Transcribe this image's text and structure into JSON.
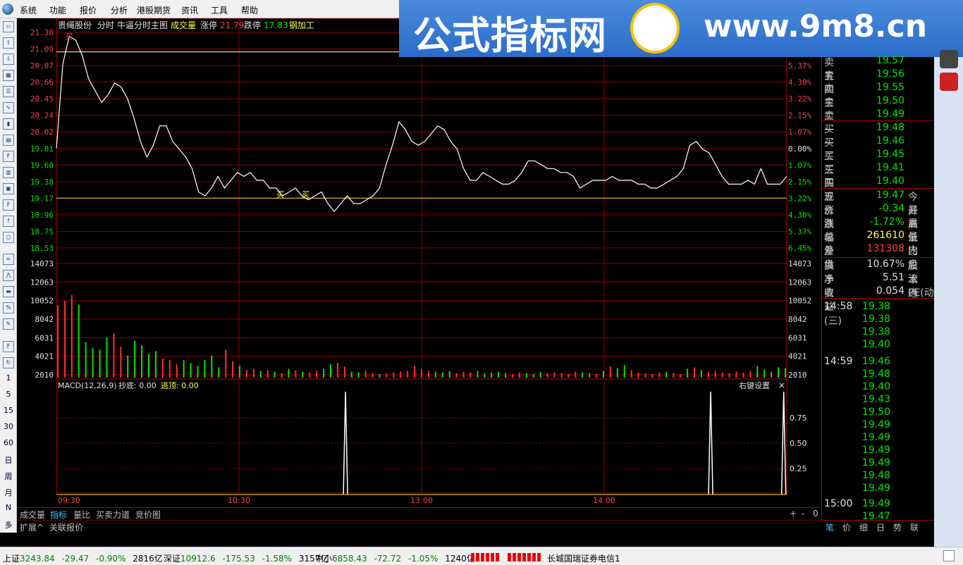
{
  "menu": [
    "系统",
    "功能",
    "报价",
    "分析",
    "港股期货",
    "资讯",
    "工具",
    "帮助"
  ],
  "watermark": {
    "cn": "公式指标网",
    "url": "www.9m8.cn"
  },
  "chart": {
    "stock_name": "贵绳股份",
    "mode": "分时",
    "indicator": "牛逼分时主图",
    "vol_label": "成交量",
    "limit_up_label": "涨停",
    "limit_up": "21.79",
    "limit_down_label": "跌停",
    "limit_down": "17.83",
    "industry": "钢加工",
    "price_ticks": [
      "21.30",
      "21.09",
      "20.87",
      "20.66",
      "20.45",
      "20.24",
      "20.02",
      "19.81",
      "19.60",
      "19.38",
      "19.17",
      "18.96",
      "18.75",
      "18.53"
    ],
    "pct_ticks": [
      "5.37%",
      "4.30%",
      "3.22%",
      "2.15%",
      "1.07%",
      "0.00%",
      "1.07%",
      "2.15%",
      "3.22%",
      "4.30%",
      "5.37%",
      "6.45%"
    ],
    "vol_ticks": [
      "14073",
      "12063",
      "10052",
      "8042",
      "6031",
      "4021",
      "2010"
    ],
    "macd_label": "MACD(12,26,9)",
    "macd_bottom": "抄底: 0.00",
    "macd_top": "逃顶: 0.00",
    "macd_setting": "右键设置",
    "macd_close": "×",
    "macd_ticks": [
      "0.75",
      "0.50",
      "0.25"
    ],
    "time_ticks": [
      "09:30",
      "10:30",
      "13:00",
      "14:00"
    ],
    "buy_mark": "买",
    "sell_marks": [
      "买",
      "买"
    ]
  },
  "chart_data": {
    "type": "line",
    "title": "贵绳股份 分时",
    "ylim": [
      18.53,
      21.3
    ],
    "price": [
      19.81,
      20.9,
      21.25,
      21.2,
      21.0,
      20.7,
      20.55,
      20.4,
      20.5,
      20.65,
      20.6,
      20.45,
      20.2,
      19.9,
      19.7,
      19.85,
      20.1,
      20.1,
      19.9,
      19.8,
      19.7,
      19.55,
      19.25,
      19.2,
      19.3,
      19.45,
      19.3,
      19.4,
      19.5,
      19.45,
      19.5,
      19.4,
      19.4,
      19.3,
      19.3,
      19.2,
      19.25,
      19.3,
      19.2,
      19.15,
      19.2,
      19.25,
      19.1,
      19.0,
      19.1,
      19.2,
      19.1,
      19.1,
      19.15,
      19.2,
      19.3,
      19.6,
      19.85,
      20.15,
      20.05,
      19.9,
      19.85,
      19.9,
      20.0,
      20.1,
      20.05,
      19.9,
      19.8,
      19.55,
      19.4,
      19.4,
      19.5,
      19.45,
      19.4,
      19.35,
      19.35,
      19.4,
      19.5,
      19.65,
      19.65,
      19.6,
      19.55,
      19.55,
      19.5,
      19.5,
      19.45,
      19.3,
      19.35,
      19.4,
      19.4,
      19.4,
      19.45,
      19.4,
      19.4,
      19.4,
      19.35,
      19.35,
      19.3,
      19.3,
      19.35,
      19.4,
      19.45,
      19.55,
      19.85,
      19.9,
      19.8,
      19.75,
      19.6,
      19.45,
      19.35,
      19.35,
      19.35,
      19.4,
      19.35,
      19.55,
      19.35,
      19.35,
      19.35,
      19.45
    ],
    "volume": [
      9800,
      10400,
      11200,
      9900,
      4800,
      4000,
      3800,
      5400,
      6000,
      4200,
      3000,
      5000,
      4400,
      3200,
      3600,
      2600,
      2400,
      1800,
      2400,
      2000,
      1600,
      2400,
      3000,
      1400,
      3800,
      2200,
      1600,
      1000,
      1200,
      900,
      1000,
      800,
      600,
      1200,
      1000,
      800,
      700,
      900,
      1200,
      1800,
      2000,
      1500,
      800,
      700,
      900,
      600,
      500,
      600,
      700,
      800,
      900,
      1600,
      1200,
      900,
      800,
      700,
      900,
      600,
      800,
      700,
      900,
      600,
      700,
      800,
      600,
      500,
      700,
      600,
      500,
      800,
      600,
      700,
      600,
      500,
      800,
      700,
      600,
      500,
      900,
      1500,
      1300,
      1700,
      1000,
      700,
      600,
      500,
      700,
      800,
      600,
      500,
      1200,
      1400,
      1000,
      800,
      900,
      700,
      600,
      800,
      700,
      900,
      1600,
      1100,
      800,
      1400,
      1300
    ],
    "macd_spikes": [
      {
        "time": "11:05",
        "value": 1.0
      },
      {
        "time": "14:35",
        "value": 1.0
      },
      {
        "time": "14:59",
        "value": 1.0
      }
    ]
  },
  "quote": {
    "asks": [
      {
        "label": "卖五",
        "price": "19.57"
      },
      {
        "label": "卖四",
        "price": "19.56"
      },
      {
        "label": "卖三",
        "price": "19.55"
      },
      {
        "label": "卖二",
        "price": "19.50"
      },
      {
        "label": "卖一",
        "price": "19.49"
      }
    ],
    "bids": [
      {
        "label": "买一",
        "price": "19.48"
      },
      {
        "label": "买二",
        "price": "19.46"
      },
      {
        "label": "买三",
        "price": "19.45"
      },
      {
        "label": "买四",
        "price": "19.41"
      },
      {
        "label": "买五",
        "price": "19.40"
      }
    ],
    "stats": [
      {
        "label": "现价",
        "value": "19.47",
        "label2": "今开",
        "cls": "green"
      },
      {
        "label": "涨跌",
        "value": "-0.34",
        "label2": "最高",
        "cls": "green"
      },
      {
        "label": "涨幅",
        "value": "-1.72%",
        "label2": "最低",
        "cls": "green"
      },
      {
        "label": "总量",
        "value": "261610",
        "label2": "量比",
        "cls": "yellow"
      },
      {
        "label": "外盘",
        "value": "131308",
        "label2": "内盘",
        "cls": "red"
      }
    ],
    "stats2": [
      {
        "label": "换手",
        "value": "10.67%",
        "label2": "股本"
      },
      {
        "label": "净资",
        "value": "5.51",
        "label2": "流通"
      },
      {
        "label": "收益(三)",
        "value": "0.054",
        "label2": "PE(动)"
      }
    ],
    "ticks": [
      {
        "time": "14:58",
        "price": "19.38"
      },
      {
        "time": "",
        "price": "19.38"
      },
      {
        "time": "",
        "price": "19.38"
      },
      {
        "time": "",
        "price": "19.40"
      },
      {
        "time": "14:59",
        "price": "19.46"
      },
      {
        "time": "",
        "price": "19.48"
      },
      {
        "time": "",
        "price": "19.40"
      },
      {
        "time": "",
        "price": "19.43"
      },
      {
        "time": "",
        "price": "19.50"
      },
      {
        "time": "",
        "price": "19.49"
      },
      {
        "time": "",
        "price": "19.49"
      },
      {
        "time": "",
        "price": "19.49"
      },
      {
        "time": "",
        "price": "19.49"
      },
      {
        "time": "",
        "price": "19.48"
      },
      {
        "time": "",
        "price": "19.49"
      },
      {
        "time": "15:00",
        "price": "19.49"
      },
      {
        "time": "",
        "price": "19.47"
      }
    ]
  },
  "bottom_tabs": [
    "成交量",
    "指标",
    "量比",
    "买卖力道",
    "竞价图"
  ],
  "bottom_controls": [
    "+",
    "-",
    "0"
  ],
  "ext_tabs": [
    "扩展^",
    "关联报价"
  ],
  "right_tabs": [
    "笔",
    "价",
    "细",
    "日",
    "势",
    "联"
  ],
  "left_nums": [
    "1",
    "5",
    "15",
    "30",
    "60",
    "日",
    "周",
    "月",
    "N",
    "多"
  ],
  "status": {
    "sh_label": "上证",
    "sh_value": "3243.84",
    "sh_chg": "-29.47",
    "sh_pct": "-0.90%",
    "sh_amt": "2816亿",
    "sz_label": "深证",
    "sz_value": "10912.6",
    "sz_chg": "-175.53",
    "sz_pct": "-1.58%",
    "sz_amt": "3157亿",
    "zx_label": "中小",
    "zx_value": "6858.43",
    "zx_chg": "-72.72",
    "zx_pct": "-1.05%",
    "zx_amt": "1240亿",
    "broker": "长城国瑞证券电信1"
  }
}
